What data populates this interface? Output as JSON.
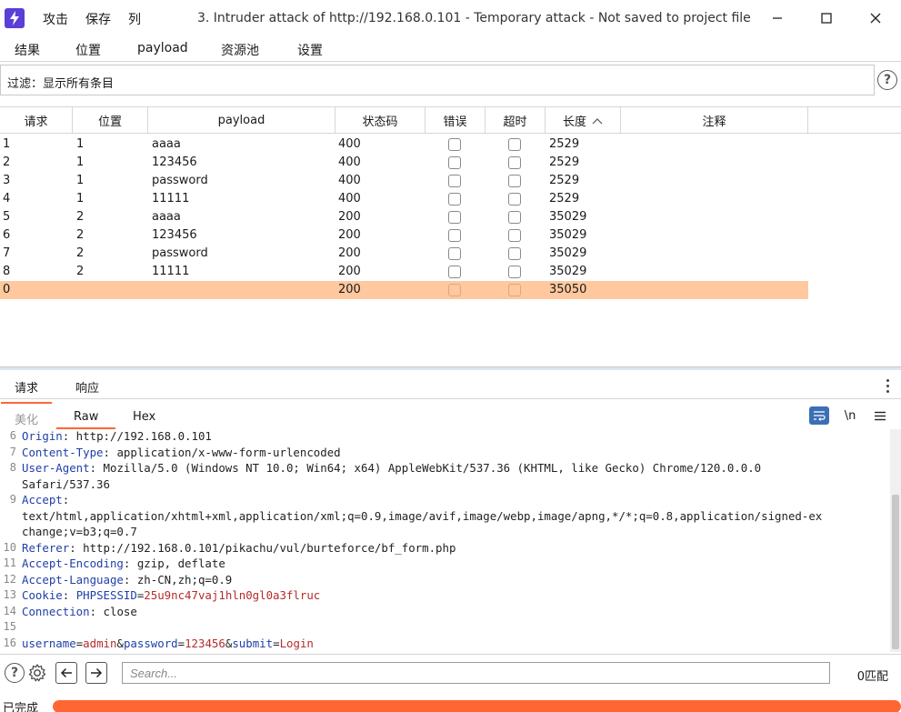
{
  "titlebar": {
    "menu": [
      "攻击",
      "保存",
      "列"
    ],
    "title": "3. Intruder attack of http://192.168.0.101 - Temporary attack - Not saved to project file"
  },
  "top_tabs": [
    "结果",
    "位置",
    "payload",
    "资源池",
    "设置"
  ],
  "filter": {
    "text": "过滤：显示所有条目"
  },
  "table": {
    "columns": [
      "请求",
      "位置",
      "payload",
      "状态码",
      "错误",
      "超时",
      "长度",
      "注释"
    ],
    "sort_column": "长度",
    "rows": [
      {
        "req": "1",
        "pos": "1",
        "payload": "aaaa",
        "status": "400",
        "error": false,
        "timeout": false,
        "length": "2529",
        "note": ""
      },
      {
        "req": "2",
        "pos": "1",
        "payload": "123456",
        "status": "400",
        "error": false,
        "timeout": false,
        "length": "2529",
        "note": ""
      },
      {
        "req": "3",
        "pos": "1",
        "payload": "password",
        "status": "400",
        "error": false,
        "timeout": false,
        "length": "2529",
        "note": ""
      },
      {
        "req": "4",
        "pos": "1",
        "payload": "11111",
        "status": "400",
        "error": false,
        "timeout": false,
        "length": "2529",
        "note": ""
      },
      {
        "req": "5",
        "pos": "2",
        "payload": "aaaa",
        "status": "200",
        "error": false,
        "timeout": false,
        "length": "35029",
        "note": ""
      },
      {
        "req": "6",
        "pos": "2",
        "payload": "123456",
        "status": "200",
        "error": false,
        "timeout": false,
        "length": "35029",
        "note": ""
      },
      {
        "req": "7",
        "pos": "2",
        "payload": "password",
        "status": "200",
        "error": false,
        "timeout": false,
        "length": "35029",
        "note": ""
      },
      {
        "req": "8",
        "pos": "2",
        "payload": "11111",
        "status": "200",
        "error": false,
        "timeout": false,
        "length": "35029",
        "note": ""
      },
      {
        "req": "0",
        "pos": "",
        "payload": "",
        "status": "200",
        "error": false,
        "timeout": false,
        "length": "35050",
        "note": "",
        "selected": true
      }
    ]
  },
  "rr_tabs": [
    "请求",
    "响应"
  ],
  "sub_tabs": [
    "美化",
    "Raw",
    "Hex"
  ],
  "toolbar": {
    "newline_label": "\\n"
  },
  "code": [
    {
      "n": "6",
      "parts": [
        [
          "k",
          "Origin"
        ],
        [
          "v",
          ": http://192.168.0.101"
        ]
      ]
    },
    {
      "n": "7",
      "parts": [
        [
          "k",
          "Content-Type"
        ],
        [
          "v",
          ": application/x-www-form-urlencoded"
        ]
      ]
    },
    {
      "n": "8",
      "parts": [
        [
          "k",
          "User-Agent"
        ],
        [
          "v",
          ": Mozilla/5.0 (Windows NT 10.0; Win64; x64) AppleWebKit/537.36 (KHTML, like Gecko) Chrome/120.0.0.0"
        ]
      ]
    },
    {
      "n": "",
      "parts": [
        [
          "v",
          "Safari/537.36"
        ]
      ]
    },
    {
      "n": "9",
      "parts": [
        [
          "k",
          "Accept"
        ],
        [
          "v",
          ":"
        ]
      ]
    },
    {
      "n": "",
      "parts": [
        [
          "v",
          "text/html,application/xhtml+xml,application/xml;q=0.9,image/avif,image/webp,image/apng,*/*;q=0.8,application/signed-ex"
        ]
      ]
    },
    {
      "n": "",
      "parts": [
        [
          "v",
          "change;v=b3;q=0.7"
        ]
      ]
    },
    {
      "n": "10",
      "parts": [
        [
          "k",
          "Referer"
        ],
        [
          "v",
          ": http://192.168.0.101/pikachu/vul/burteforce/bf_form.php"
        ]
      ]
    },
    {
      "n": "11",
      "parts": [
        [
          "k",
          "Accept-Encoding"
        ],
        [
          "v",
          ": gzip, deflate"
        ]
      ]
    },
    {
      "n": "12",
      "parts": [
        [
          "k",
          "Accept-Language"
        ],
        [
          "v",
          ": zh-CN,zh;q=0.9"
        ]
      ]
    },
    {
      "n": "13",
      "parts": [
        [
          "k",
          "Cookie"
        ],
        [
          "v",
          ": "
        ],
        [
          "k",
          "PHPSESSID"
        ],
        [
          "v",
          "="
        ],
        [
          "pv",
          "25u9nc47vaj1hln0gl0a3flruc"
        ]
      ]
    },
    {
      "n": "14",
      "parts": [
        [
          "k",
          "Connection"
        ],
        [
          "v",
          ": close"
        ]
      ]
    },
    {
      "n": "15",
      "parts": []
    },
    {
      "n": "16",
      "parts": [
        [
          "k",
          "username"
        ],
        [
          "v",
          "="
        ],
        [
          "pv",
          "admin"
        ],
        [
          "v",
          "&"
        ],
        [
          "k",
          "password"
        ],
        [
          "v",
          "="
        ],
        [
          "pv",
          "123456"
        ],
        [
          "v",
          "&"
        ],
        [
          "k",
          "submit"
        ],
        [
          "v",
          "="
        ],
        [
          "pv",
          "Login"
        ]
      ]
    }
  ],
  "search": {
    "placeholder": "Search...",
    "value": "",
    "match_count": "0匹配"
  },
  "status": {
    "text": "已完成",
    "progress": 1.0
  },
  "colors": {
    "accent": "#ff6633",
    "selected_row": "#ffc89e",
    "app_icon": "#5b3fd6",
    "wrap_button": "#3b6fb6"
  }
}
